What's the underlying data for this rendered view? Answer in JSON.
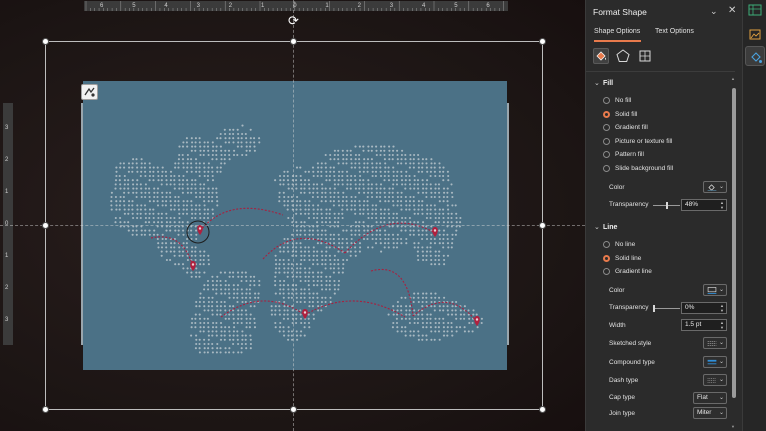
{
  "ruler": {
    "h_labels": [
      "6",
      "5",
      "4",
      "3",
      "2",
      "1",
      "0",
      "1",
      "2",
      "3",
      "4",
      "5",
      "6"
    ],
    "v_labels": [
      "3",
      "2",
      "1",
      "0",
      "1",
      "2",
      "3"
    ]
  },
  "pane": {
    "title": "Format Shape",
    "tabs": {
      "shape_options": "Shape Options",
      "text_options": "Text Options"
    },
    "fill": {
      "heading": "Fill",
      "options": [
        {
          "label": "No fill",
          "selected": false
        },
        {
          "label": "Solid fill",
          "selected": true
        },
        {
          "label": "Gradient fill",
          "selected": false
        },
        {
          "label": "Picture or texture fill",
          "selected": false
        },
        {
          "label": "Pattern fill",
          "selected": false
        },
        {
          "label": "Slide background fill",
          "selected": false
        }
      ],
      "color_label": "Color",
      "transparency_label": "Transparency",
      "transparency_value": "48%",
      "transparency_fraction": 0.48
    },
    "line": {
      "heading": "Line",
      "options": [
        {
          "label": "No line",
          "selected": false
        },
        {
          "label": "Solid line",
          "selected": true
        },
        {
          "label": "Gradient line",
          "selected": false
        }
      ],
      "color_label": "Color",
      "transparency_label": "Transparency",
      "transparency_value": "0%",
      "transparency_fraction": 0.0,
      "width_label": "Width",
      "width_value": "1.5 pt",
      "sketched_label": "Sketched style",
      "compound_label": "Compound type",
      "dash_label": "Dash type",
      "cap_label": "Cap type",
      "cap_value": "Flat",
      "join_label": "Join type",
      "join_value": "Miter"
    }
  },
  "colors": {
    "accent": "#e87a4c",
    "slide_bg": "#4b7186",
    "map_dots": "#a9b9c2",
    "route": "#a8203f",
    "pin": "#b0213f"
  },
  "icons": {
    "rotate": "rotate-handle-icon",
    "layout_options": "layout-options-icon",
    "fill_line": "paint-bucket-icon",
    "effects": "pentagon-icon",
    "size_properties": "size-properties-icon",
    "close": "close-icon",
    "collapse": "chevron-down-icon"
  }
}
